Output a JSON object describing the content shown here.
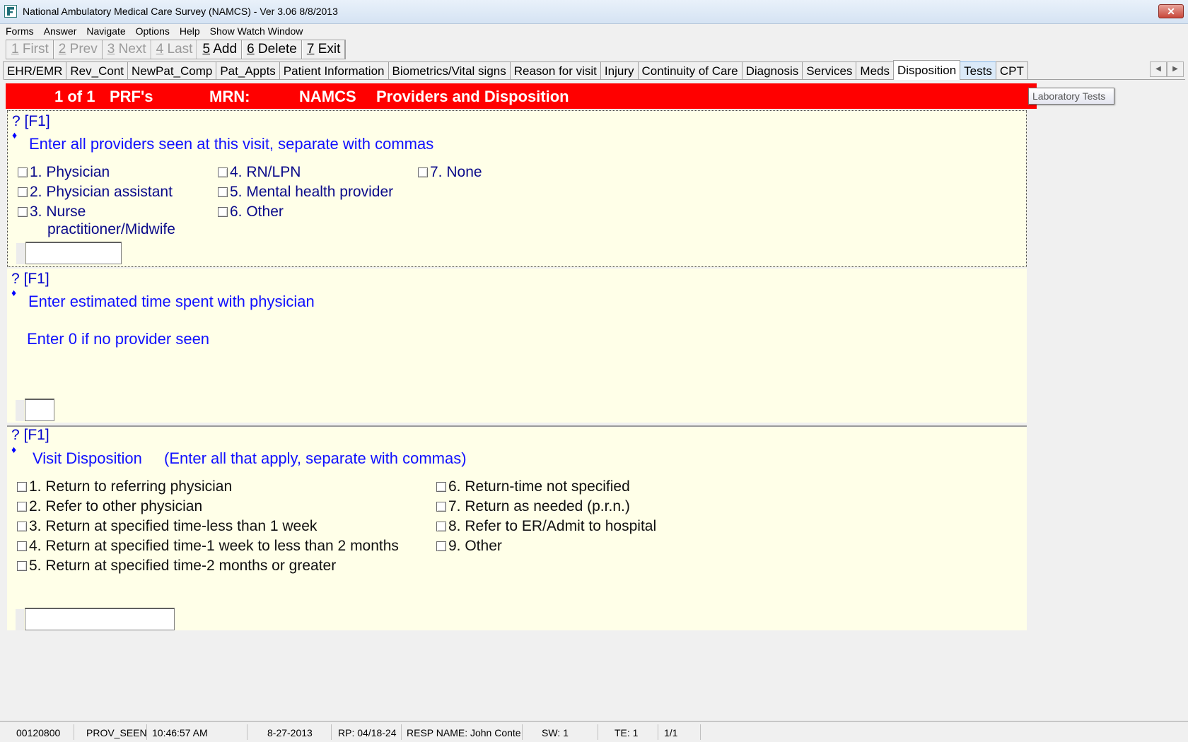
{
  "window": {
    "title": "National Ambulatory Medical Care Survey (NAMCS) - Ver 3.06 8/8/2013",
    "close_label": "✕"
  },
  "menu": [
    "Forms",
    "Answer",
    "Navigate",
    "Options",
    "Help",
    "Show Watch Window"
  ],
  "toolbar": {
    "first": {
      "num": "1",
      "label": " First"
    },
    "prev": {
      "num": "2",
      "label": " Prev"
    },
    "next": {
      "num": "3",
      "label": " Next"
    },
    "last": {
      "num": "4",
      "label": " Last"
    },
    "add": {
      "num": "5",
      "label": " Add"
    },
    "delete": {
      "num": "6",
      "label": " Delete"
    },
    "exit": {
      "num": "7",
      "label": " Exit"
    }
  },
  "tabs": [
    "EHR/EMR",
    "Rev_Cont",
    "NewPat_Comp",
    "Pat_Appts",
    "Patient Information",
    "Biometrics/Vital signs",
    "Reason for visit",
    "Injury",
    "Continuity of Care",
    "Diagnosis",
    "Services",
    "Meds",
    "Disposition",
    "Tests",
    "CPT"
  ],
  "active_tab": "Disposition",
  "tooltip": "Laboratory Tests",
  "header": {
    "count": "1 of 1",
    "prf": "PRF's",
    "mrn": "MRN:",
    "namcs": "NAMCS",
    "section": "Providers and Disposition",
    "color": "#ff0000"
  },
  "help_label": "? [F1]",
  "bullet": "♦",
  "q1": {
    "question": "Enter all providers seen at this visit, separate with commas",
    "options": [
      "1. Physician",
      "2. Physician assistant",
      "3. Nurse",
      "practitioner/Midwife",
      "4. RN/LPN",
      "5. Mental health provider",
      "6. Other",
      "7. None"
    ],
    "value": ""
  },
  "q2": {
    "question": "Enter estimated time spent with physician",
    "note": "Enter 0 if no provider seen",
    "value": ""
  },
  "q3": {
    "question": "Visit Disposition",
    "hint": "(Enter all that apply, separate with commas)",
    "options": [
      "1. Return to referring physician",
      "2. Refer to other physician",
      "3. Return at specified time-less than 1 week",
      "4. Return at specified time-1 week to less than 2 months",
      "5. Return at specified time-2 months or greater",
      "6. Return-time not specified",
      "7. Return as needed (p.r.n.)",
      "8. Refer to ER/Admit to hospital",
      "9. Other"
    ],
    "value": ""
  },
  "status": {
    "id": "00120800",
    "field": "PROV_SEEN",
    "time": "10:46:57 AM",
    "date": "8-27-2013",
    "rp": "RP: 04/18-24",
    "resp": "RESP NAME: John  Conte",
    "sw": "SW: 1",
    "te": "TE: 1",
    "page": "1/1"
  }
}
